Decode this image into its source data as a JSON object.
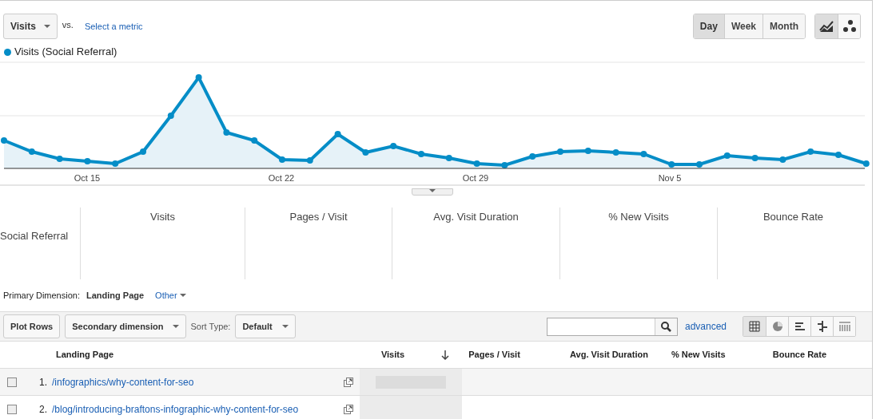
{
  "metric_selector": {
    "metric": "Visits",
    "vs": "vs.",
    "link": "Select a metric"
  },
  "period_tabs": [
    {
      "label": "Day",
      "selected": true
    },
    {
      "label": "Week",
      "selected": false
    },
    {
      "label": "Month",
      "selected": false
    }
  ],
  "chart_types": [
    {
      "kind": "line",
      "selected": true
    },
    {
      "kind": "motion",
      "selected": false
    }
  ],
  "legend": {
    "label": "Visits (Social Referral)"
  },
  "chart": {
    "x_labels": [
      "Oct 15",
      "Oct 22",
      "Oct 29",
      "Nov 5"
    ]
  },
  "summary": {
    "segment": "Social Referral",
    "metrics": [
      "Visits",
      "Pages / Visit",
      "Avg. Visit Duration",
      "% New Visits",
      "Bounce Rate"
    ]
  },
  "primary_dimension": {
    "label": "Primary Dimension:",
    "value": "Landing Page",
    "other": "Other"
  },
  "toolbar": {
    "plot_rows": "Plot Rows",
    "secondary": "Secondary dimension",
    "sort_label": "Sort Type:",
    "sort_value": "Default",
    "advanced": "advanced",
    "views": [
      {
        "kind": "table",
        "selected": true
      },
      {
        "kind": "pie",
        "selected": false
      },
      {
        "kind": "bar",
        "selected": false
      },
      {
        "kind": "comparison",
        "selected": false
      },
      {
        "kind": "pivot",
        "selected": false
      }
    ]
  },
  "table": {
    "columns": [
      "Landing Page",
      "Visits",
      "Pages / Visit",
      "Avg. Visit Duration",
      "% New Visits",
      "Bounce Rate"
    ],
    "rows": [
      {
        "number": "1.",
        "page": "/infographics/why-content-for-seo",
        "checked": false
      },
      {
        "number": "2.",
        "page": "/blog/introducing-braftons-infographic-why-content-for-seo",
        "checked": false
      }
    ]
  }
}
